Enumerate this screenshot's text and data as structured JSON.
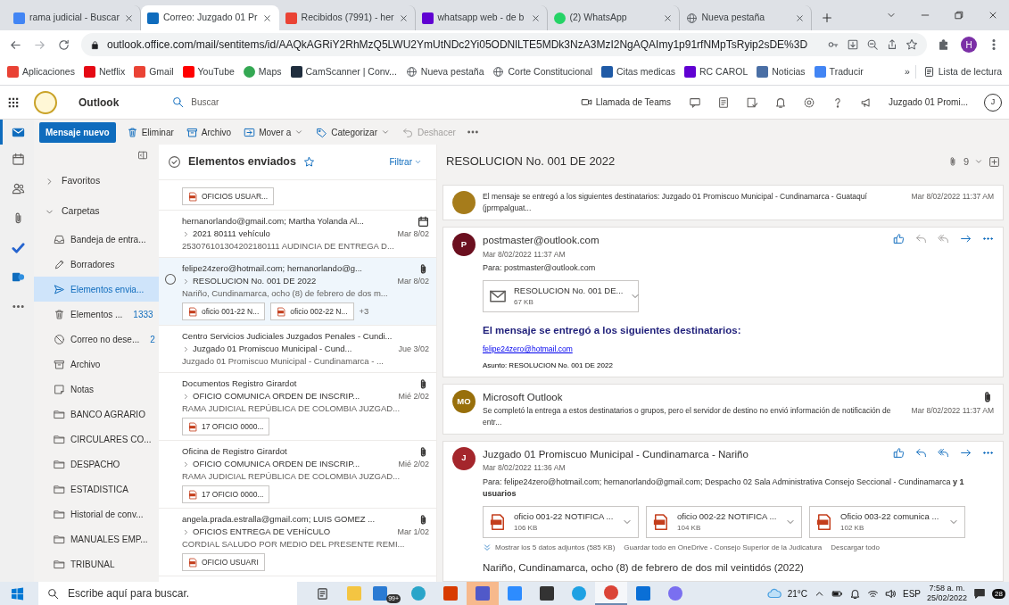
{
  "browser": {
    "tabs": [
      {
        "title": "rama judicial - Buscar",
        "selected": false
      },
      {
        "title": "Correo: Juzgado 01 Pr",
        "selected": true
      },
      {
        "title": "Recibidos (7991) - her",
        "selected": false
      },
      {
        "title": "whatsapp web - de b",
        "selected": false
      },
      {
        "title": "(2) WhatsApp",
        "selected": false
      },
      {
        "title": "Nueva pestaña",
        "selected": false
      }
    ],
    "url": "outlook.office.com/mail/sentitems/id/AAQkAGRiY2RhMzQ5LWU2YmUtNDc2Yi05ODNlLTE5MDk3NzA3MzI2NgAQAImy1p91rfNMpTsRyip2sDE%3D",
    "profile": "H",
    "bookmarks": [
      {
        "label": "Aplicaciones"
      },
      {
        "label": "Netflix"
      },
      {
        "label": "Gmail"
      },
      {
        "label": "YouTube"
      },
      {
        "label": "Maps"
      },
      {
        "label": "CamScanner | Conv..."
      },
      {
        "label": "Nueva pestaña"
      },
      {
        "label": "Corte Constitucional"
      },
      {
        "label": "Citas medicas"
      },
      {
        "label": "RC CAROL"
      },
      {
        "label": "Noticias"
      },
      {
        "label": "Traducir"
      }
    ],
    "bookmarks_more": "»",
    "reading_list": "Lista de lectura"
  },
  "outlook": {
    "app_name": "Outlook",
    "search_placeholder": "Buscar",
    "teams_call": "Llamada de Teams",
    "account": "Juzgado 01 Promi...",
    "avatar": "J"
  },
  "rail": [
    {
      "selected": true
    },
    {
      "selected": false
    },
    {
      "selected": false
    },
    {
      "selected": false
    },
    {
      "selected": false
    },
    {
      "selected": false
    },
    {
      "selected": false
    }
  ],
  "toolbar": {
    "new_message": "Mensaje nuevo",
    "actions": [
      {
        "label": "Eliminar",
        "dropdown": false,
        "disabled": false
      },
      {
        "label": "Archivo",
        "dropdown": false,
        "disabled": false
      },
      {
        "label": "Mover a",
        "dropdown": true,
        "disabled": false
      },
      {
        "label": "Categorizar",
        "dropdown": true,
        "disabled": false
      },
      {
        "label": "Deshacer",
        "dropdown": false,
        "disabled": true
      }
    ]
  },
  "folders": {
    "groups": [
      {
        "label": "Favoritos",
        "expanded": false
      },
      {
        "label": "Carpetas",
        "expanded": true,
        "children": [
          {
            "name": "Bandeja de entra...",
            "selected": false
          },
          {
            "name": "Borradores",
            "selected": false
          },
          {
            "name": "Elementos envia...",
            "selected": true
          },
          {
            "name": "Elementos ...",
            "count": "1333",
            "selected": false
          },
          {
            "name": "Correo no dese...",
            "count": "2",
            "selected": false
          },
          {
            "name": "Archivo",
            "selected": false
          },
          {
            "name": "Notas",
            "selected": false
          },
          {
            "name": "BANCO AGRARIO",
            "selected": false
          },
          {
            "name": "CIRCULARES CO...",
            "selected": false
          },
          {
            "name": "DESPACHO",
            "selected": false
          },
          {
            "name": "ESTADISTICA",
            "selected": false
          },
          {
            "name": "Historial de conv...",
            "selected": false
          },
          {
            "name": "MANUALES EMP...",
            "selected": false
          },
          {
            "name": "TRIBUNAL",
            "selected": false
          }
        ]
      }
    ]
  },
  "message_list": {
    "title": "Elementos enviados",
    "filter": "Filtrar",
    "messages": [
      {
        "attachments": [
          "OFICIOS USUAR..."
        ],
        "selected": false
      },
      {
        "from": "hernanorlando@gmail.com; Martha Yolanda Al...",
        "is_invite": true,
        "has_attachment": false,
        "subject": "2021 80111 vehículo",
        "date": "Mar 8/02",
        "preview": "253076101304202180111 AUDINCIA DE ENTREGA D...",
        "selected": false
      },
      {
        "from": "felipe24zero@hotmail.com; hernanorlando@g...",
        "is_invite": false,
        "has_attachment": true,
        "subject": "RESOLUCION No. 001 DE 2022",
        "date": "Mar 8/02",
        "preview": "Nariño, Cundinamarca, ocho (8) de febrero de dos m...",
        "attachments": [
          "oficio 001-22 N...",
          "oficio 002-22 N..."
        ],
        "more_attachments": "+3",
        "selected": true
      },
      {
        "from": "Centro Servicios Judiciales Juzgados Penales - Cundi...",
        "is_invite": false,
        "has_attachment": false,
        "subject": "Juzgado 01 Promiscuo Municipal - Cund...",
        "date": "Jue 3/02",
        "preview": "Juzgado 01 Promiscuo Municipal - Cundinamarca - ...",
        "selected": false
      },
      {
        "from": "Documentos Registro Girardot",
        "is_invite": false,
        "has_attachment": true,
        "subject": "OFICIO COMUNICA ORDEN DE INSCRIP...",
        "date": "Mié 2/02",
        "preview": "RAMA JUDICIAL REPÚBLICA DE COLOMBIA JUZGAD...",
        "attachments": [
          "17 OFICIO 0000..."
        ],
        "selected": false
      },
      {
        "from": "Oficina de Registro Girardot",
        "is_invite": false,
        "has_attachment": true,
        "subject": "OFICIO COMUNICA ORDEN DE INSCRIP...",
        "date": "Mié 2/02",
        "preview": "RAMA JUDICIAL REPÚBLICA DE COLOMBIA JUZGAD...",
        "attachments": [
          "17 OFICIO 0000..."
        ],
        "selected": false
      },
      {
        "from": "angela.prada.estralla@gmail.com; LUIS GOMEZ ...",
        "is_invite": false,
        "has_attachment": true,
        "subject": "OFICIOS ENTREGA DE VEHÍCULO",
        "date": "Mar 1/02",
        "preview": "CORDIAL SALUDO POR MEDIO DEL PRESENTE REMI...",
        "attachments": [
          "OFICIO USUARI"
        ],
        "selected": false
      }
    ]
  },
  "reading_pane": {
    "subject": "RESOLUCION No. 001 DE 2022",
    "attachment_count": "9",
    "items": [
      {
        "kind": "collapsed",
        "color": "#a67c1b",
        "preview": "El mensaje se entregó a los siguientes destinatarios: Juzgado 01 Promiscuo Municipal - Cundinamarca - Guataquí (jprmpalguat...",
        "date": "Mar 8/02/2022 11:37 AM"
      },
      {
        "kind": "expanded",
        "initials": "P",
        "color": "#6b0f1f",
        "sender": "postmaster@outlook.com",
        "date": "Mar 8/02/2022 11:37 AM",
        "to_label": "Para:",
        "to": "postmaster@outlook.com",
        "reply_enabled": false,
        "attachments": [
          {
            "name": "RESOLUCION No. 001 DE...",
            "size": "67 KB"
          }
        ],
        "body": [
          {
            "kind": "heading",
            "text": "El mensaje se entregó a los siguientes destinatarios:"
          },
          {
            "kind": "link",
            "text": "felipe24zero@hotmail.com"
          },
          {
            "kind": "small",
            "text": "Asunto: RESOLUCION No. 001 DE 2022"
          }
        ]
      },
      {
        "kind": "collapsed",
        "initials": "MO",
        "color": "#986f0b",
        "sender": "Microsoft Outlook",
        "preview": "Se completó la entrega a estos destinatarios o grupos, pero el servidor de destino no envió información de notificación de entr...",
        "date": "Mar 8/02/2022 11:37 AM",
        "has_attachment": true
      },
      {
        "kind": "expanded",
        "initials": "J",
        "color": "#a4262c",
        "sender": "Juzgado 01 Promiscuo Municipal - Cundinamarca - Nariño",
        "date": "Mar 8/02/2022 11:36 AM",
        "to_label": "Para:",
        "to": "felipe24zero@hotmail.com; hernanorlando@gmail.com; Despacho 02 Sala Administrativa Consejo Seccional - Cundinamarca **y 1 usuarios**",
        "reply_enabled": true,
        "attachments": [
          {
            "name": "oficio 001-22 NOTIFICA ...",
            "size": "106 KB"
          },
          {
            "name": "oficio 002-22 NOTIFICA ...",
            "size": "104 KB"
          },
          {
            "name": "Oficio 003-22 comunica ...",
            "size": "102 KB"
          }
        ],
        "attachment_links": [
          "Mostrar los 5 datos adjuntos (585 KB)",
          "Guardar todo en OneDrive - Consejo Superior de la Judicatura",
          "Descargar todo"
        ],
        "body": [
          {
            "kind": "plain",
            "text": "Nariño, Cundinamarca, ocho (8) de febrero de dos mil veintidós (2022)"
          }
        ]
      }
    ]
  },
  "taskbar": {
    "search_placeholder": "Escribe aquí para buscar.",
    "apps": [
      {
        "flashing": false,
        "open": false
      },
      {
        "flashing": false,
        "open": false
      },
      {
        "badge": "99+",
        "flashing": false,
        "open": false
      },
      {
        "flashing": false,
        "open": false
      },
      {
        "flashing": false,
        "open": false
      },
      {
        "flashing": true,
        "open": false
      },
      {
        "flashing": false,
        "open": false
      },
      {
        "flashing": false,
        "open": false
      },
      {
        "flashing": false,
        "open": false
      },
      {
        "flashing": false,
        "open": true
      },
      {
        "flashing": false,
        "open": false
      },
      {
        "flashing": false,
        "open": false
      }
    ],
    "weather": "21°C",
    "language": "ESP",
    "time": "7:58 a. m.",
    "date": "25/02/2022",
    "notifications": "28"
  }
}
